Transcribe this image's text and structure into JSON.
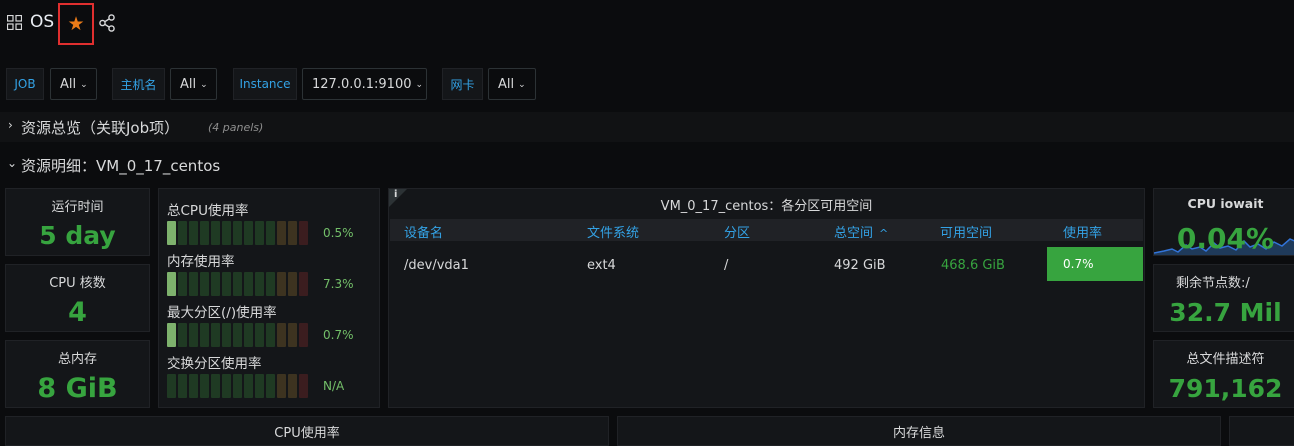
{
  "header": {
    "title": "OS"
  },
  "variables": [
    {
      "label": "JOB",
      "value": "All"
    },
    {
      "label": "主机名",
      "value": "All"
    },
    {
      "label": "Instance",
      "value": "127.0.0.1:9100"
    },
    {
      "label": "网卡",
      "value": "All"
    }
  ],
  "rows": {
    "overview": {
      "title": "资源总览（关联Job项）",
      "subtitle": "(4 panels)"
    },
    "detail": {
      "title": "资源明细：VM_0_17_centos"
    }
  },
  "stats_left": [
    {
      "title": "运行时间",
      "value": "5 day"
    },
    {
      "title": "CPU 核数",
      "value": "4"
    },
    {
      "title": "总内存",
      "value": "8 GiB"
    }
  ],
  "bar_gauges": [
    {
      "label": "总CPU使用率",
      "value": "0.5%",
      "level": 0.005
    },
    {
      "label": "内存使用率",
      "value": "7.3%",
      "level": 0.073
    },
    {
      "label": "最大分区(/)使用率",
      "value": "0.7%",
      "level": 0.007
    },
    {
      "label": "交换分区使用率",
      "value": "N/A",
      "level": 0
    }
  ],
  "table": {
    "info_icon": "i",
    "title": "VM_0_17_centos：各分区可用空间",
    "columns": [
      "设备名",
      "文件系统",
      "分区",
      "总空间",
      "可用空间",
      "使用率"
    ],
    "sort_indicator": "^",
    "rows": [
      {
        "device": "/dev/vda1",
        "fs": "ext4",
        "mount": "/",
        "total": "492 GiB",
        "avail": "468.6 GiB",
        "usage": "0.7%"
      }
    ]
  },
  "stats_right": [
    {
      "title": "CPU iowait",
      "value": "0.04%"
    },
    {
      "title": "剩余节点数:/",
      "value": "32.7 Mil"
    },
    {
      "title": "总文件描述符",
      "value": "791,162"
    }
  ],
  "bottom_panels": [
    {
      "title": "CPU使用率"
    },
    {
      "title": "内存信息"
    }
  ],
  "colors": {
    "accent_blue": "#33a2e5",
    "stat_green": "#37a43f",
    "star_orange": "#eb7b18",
    "highlight_red": "#e02f2f"
  },
  "icons": [
    "grid-icon",
    "star-icon",
    "share-icon",
    "info-icon",
    "chevron-right-icon",
    "chevron-down-icon"
  ]
}
